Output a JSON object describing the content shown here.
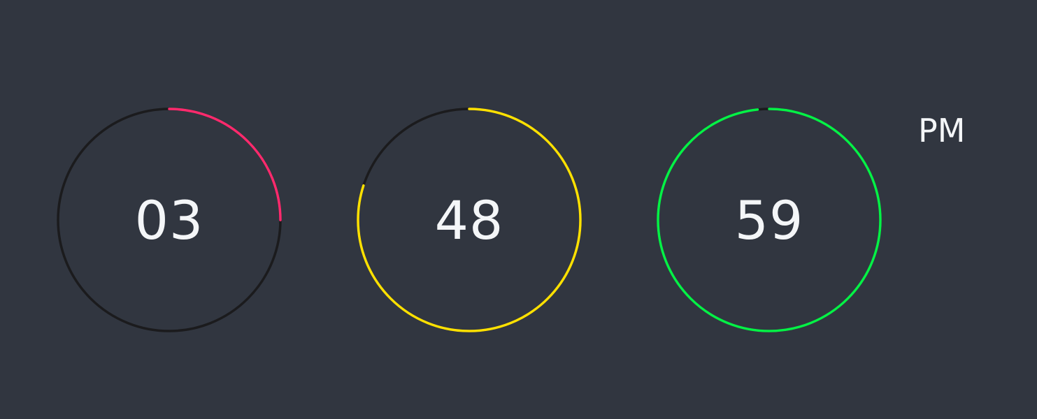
{
  "clock": {
    "hours": {
      "value": "03",
      "fraction": 0.25,
      "color": "#ff2a6d",
      "track_color": "#1b1b1d"
    },
    "minutes": {
      "value": "48",
      "fraction": 0.8,
      "color": "#ffe102",
      "track_color": "#1b1b1d"
    },
    "seconds": {
      "value": "59",
      "fraction": 0.983,
      "color": "#05f146",
      "track_color": "#1b1b1d"
    },
    "meridiem": "PM",
    "background": "#313640"
  }
}
